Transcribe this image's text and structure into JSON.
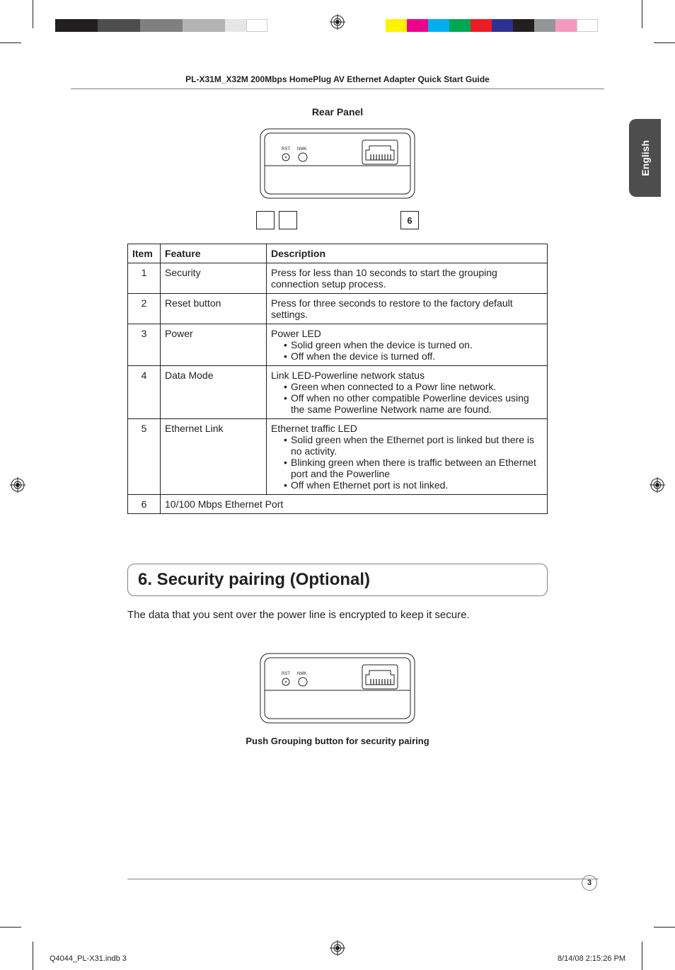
{
  "print": {
    "colors_left": [
      "c-black",
      "c-black",
      "c-dgray",
      "c-mgray",
      "c-lgray",
      "c-vlgray",
      "c-white",
      "c-white",
      "c-white",
      "c-white"
    ],
    "colors_right": [
      "c-yellow",
      "c-magenta",
      "c-cyan",
      "c-green",
      "c-red",
      "c-blue",
      "c-pblack",
      "c-gray50",
      "c-pink",
      "c-white2"
    ]
  },
  "header": "PL-X31M_X32M 200Mbps HomePlug AV Ethernet Adapter Quick Start Guide",
  "language_tab": "English",
  "panel_title": "Rear Panel",
  "callouts": {
    "a": "",
    "b": "",
    "c": "6"
  },
  "table": {
    "head": {
      "item": "Item",
      "feature": "Feature",
      "description": "Description"
    },
    "rows": [
      {
        "item": "1",
        "feature": "Security",
        "desc": "Press for less than 10 seconds to start the grouping connection setup process."
      },
      {
        "item": "2",
        "feature": "Reset button",
        "desc": "Press for three seconds to restore to the factory default settings."
      },
      {
        "item": "3",
        "feature": "Power",
        "desc_head": "Power LED",
        "bullets": [
          "Solid green when the device is turned on.",
          "Off when the device is turned off."
        ]
      },
      {
        "item": "4",
        "feature": "Data Mode",
        "desc_head": "Link LED-Powerline network status",
        "bullets": [
          "Green when connected to a Powr line network.",
          "Off when no other compatible Powerline devices using the same Powerline Network name are found."
        ]
      },
      {
        "item": "5",
        "feature": "Ethernet Link",
        "desc_head": "Ethernet traffic LED",
        "bullets": [
          "Solid green when the Ethernet port is linked but there is no activity.",
          "Blinking green when there is traffic between an Ethernet port and the Powerline",
          "Off when Ethernet port is not linked."
        ]
      },
      {
        "item": "6",
        "feature_span": "10/100 Mbps Ethernet Port"
      }
    ]
  },
  "section": {
    "heading": "6. Security pairing (Optional)",
    "text": "The data that you sent over the power line is encrypted to keep it secure.",
    "caption": "Push Grouping button for security pairing"
  },
  "page_number": "3",
  "slug": {
    "left": "Q4044_PL-X31.indb   3",
    "right": "8/14/08   2:15:26 PM"
  },
  "device": {
    "rst_label": "RST",
    "nmk_label": "NMK"
  }
}
